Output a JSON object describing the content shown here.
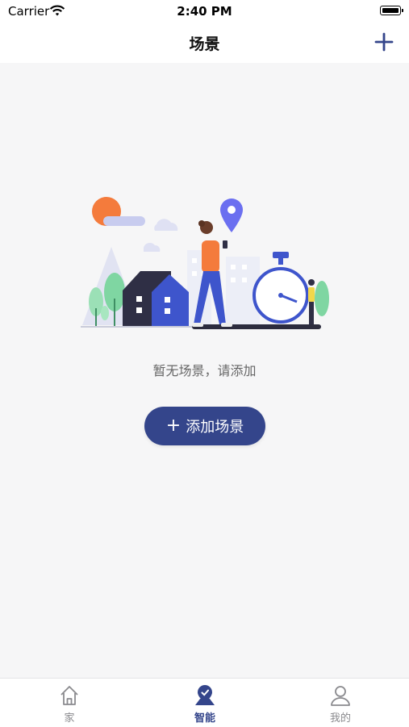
{
  "status_bar": {
    "carrier": "Carrier",
    "time": "2:40 PM"
  },
  "nav": {
    "title": "场景"
  },
  "empty_state": {
    "message": "暂无场景，请添加"
  },
  "add_button": {
    "plus": "+",
    "label": "添加场景"
  },
  "tabs": [
    {
      "label": "家",
      "icon": "home-icon"
    },
    {
      "label": "智能",
      "icon": "smart-icon",
      "active": true
    },
    {
      "label": "我的",
      "icon": "person-icon"
    }
  ],
  "colors": {
    "accent": "#34458b",
    "background": "#f6f6f7"
  }
}
